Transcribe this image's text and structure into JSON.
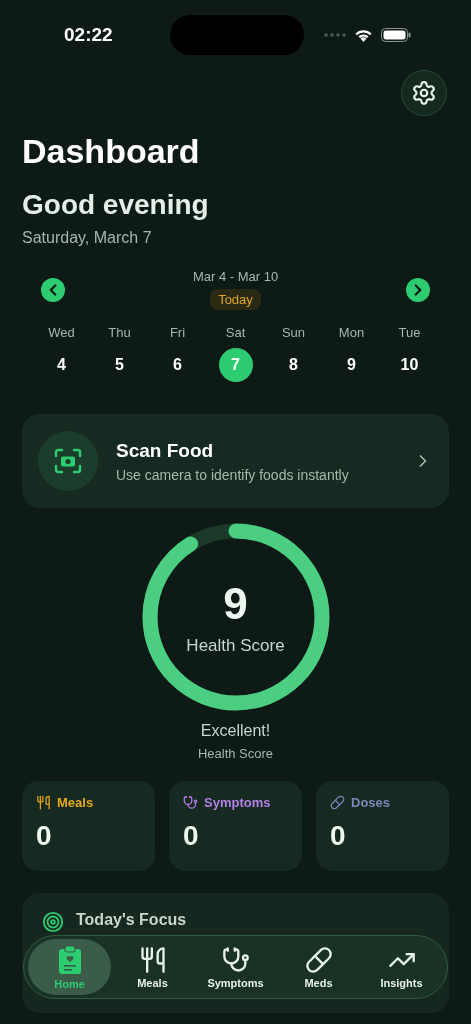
{
  "status_bar": {
    "time": "02:22"
  },
  "header": {
    "title": "Dashboard",
    "greeting": "Good evening",
    "date": "Saturday, March 7"
  },
  "week": {
    "range": "Mar 4 - Mar 10",
    "today_label": "Today",
    "days": [
      {
        "name": "Wed",
        "number": "4",
        "selected": false
      },
      {
        "name": "Thu",
        "number": "5",
        "selected": false
      },
      {
        "name": "Fri",
        "number": "6",
        "selected": false
      },
      {
        "name": "Sat",
        "number": "7",
        "selected": true
      },
      {
        "name": "Sun",
        "number": "8",
        "selected": false
      },
      {
        "name": "Mon",
        "number": "9",
        "selected": false
      },
      {
        "name": "Tue",
        "number": "10",
        "selected": false
      }
    ]
  },
  "scan_card": {
    "title": "Scan Food",
    "subtitle": "Use camera to identify foods instantly"
  },
  "health_score": {
    "value": "9",
    "label": "Health Score",
    "level": 0.91,
    "rating": "Excellent!",
    "caption": "Health Score"
  },
  "stats": [
    {
      "kind": "meals",
      "label": "Meals",
      "value": "0",
      "color": "#e6a817"
    },
    {
      "kind": "symptoms",
      "label": "Symptoms",
      "value": "0",
      "color": "#b57ee8"
    },
    {
      "kind": "doses",
      "label": "Doses",
      "value": "0",
      "color": "#7a86b8"
    }
  ],
  "focus_card": {
    "title": "Today's Focus"
  },
  "tab_bar": [
    {
      "kind": "home",
      "label": "Home",
      "selected": true
    },
    {
      "kind": "meals",
      "label": "Meals",
      "selected": false
    },
    {
      "kind": "symptoms",
      "label": "Symptoms",
      "selected": false
    },
    {
      "kind": "meds",
      "label": "Meds",
      "selected": false
    },
    {
      "kind": "insights",
      "label": "Insights",
      "selected": false
    }
  ]
}
